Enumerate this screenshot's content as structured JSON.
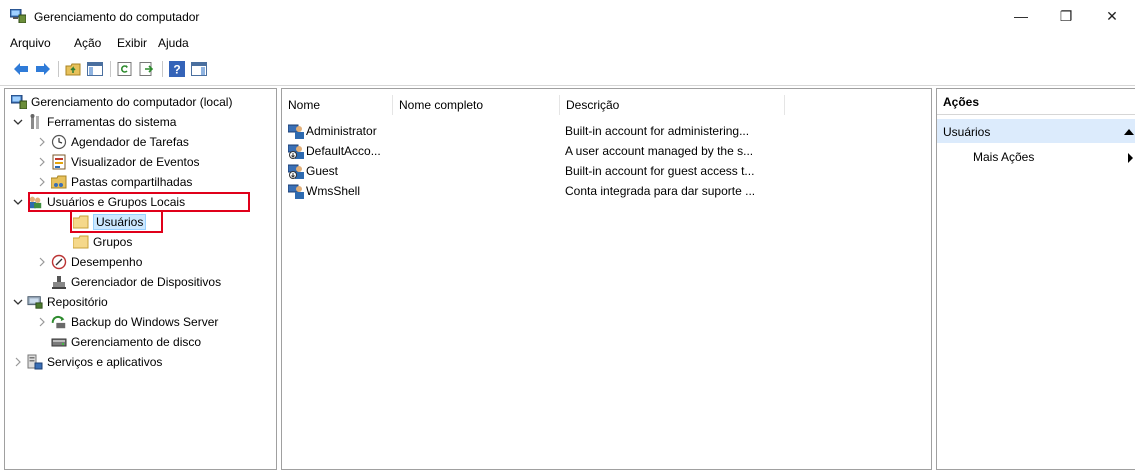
{
  "window": {
    "title": "Gerenciamento do computador",
    "minimize_glyph": "—",
    "maximize_glyph": "❐",
    "close_glyph": "✕"
  },
  "menu": [
    "Arquivo",
    "Ação",
    "Exibir",
    "Ajuda"
  ],
  "toolbar": {
    "icons": [
      "back-arrow-icon",
      "forward-arrow-icon",
      "up-folder-icon",
      "show-hide-tree-icon",
      "refresh-icon",
      "export-list-icon",
      "help-icon",
      "show-hide-action-pane-icon"
    ]
  },
  "tree": {
    "root": "Gerenciamento do computador (local)",
    "system_tools": "Ferramentas do sistema",
    "task_scheduler": "Agendador de Tarefas",
    "event_viewer": "Visualizador de Eventos",
    "shared_folders": "Pastas compartilhadas",
    "local_users_groups": "Usuários e Grupos Locais",
    "users": "Usuários",
    "groups": "Grupos",
    "performance": "Desempenho",
    "device_manager": "Gerenciador de Dispositivos",
    "storage": "Repositório",
    "windows_server_backup": "Backup do Windows Server",
    "disk_management": "Gerenciamento de disco",
    "services_apps": "Serviços e aplicativos"
  },
  "list": {
    "columns": [
      "Nome",
      "Nome completo",
      "Descrição"
    ],
    "rows": [
      {
        "name": "Administrator",
        "full_name": "",
        "description": "Built-in account for administering..."
      },
      {
        "name": "DefaultAcco...",
        "full_name": "",
        "description": "A user account managed by the s..."
      },
      {
        "name": "Guest",
        "full_name": "",
        "description": "Built-in account for guest access t..."
      },
      {
        "name": "WmsShell",
        "full_name": "",
        "description": "Conta integrada para dar suporte ..."
      }
    ]
  },
  "actions": {
    "title": "Ações",
    "section": "Usuários",
    "more": "Mais Ações"
  },
  "colors": {
    "highlight_red": "#e0001a",
    "selection_blue": "#cce8ff",
    "action_section_bg": "#dcebfc"
  }
}
